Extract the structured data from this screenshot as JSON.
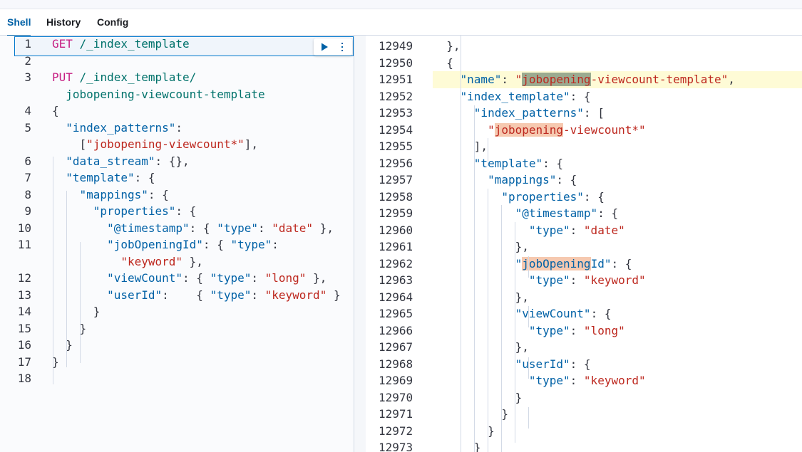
{
  "tabs": [
    {
      "label": "Shell",
      "active": true
    },
    {
      "label": "History",
      "active": false
    },
    {
      "label": "Config",
      "active": false
    }
  ],
  "request_actions": {
    "run_icon": "play-icon",
    "menu_icon": "more-vertical-icon"
  },
  "colors": {
    "accent": "#0061a6",
    "key": "#0061a6",
    "string": "#bd271e",
    "method": "#c61e82",
    "url": "#00726b",
    "selection": "#f6c9b0"
  },
  "left_editor": {
    "lines": [
      {
        "n": "1",
        "tokens": [
          [
            "m",
            "GET"
          ],
          [
            "u",
            " /_index_template"
          ]
        ]
      },
      {
        "n": "2",
        "tokens": []
      },
      {
        "n": "3",
        "tokens": [
          [
            "m",
            "PUT"
          ],
          [
            "u",
            " /_index_template/"
          ]
        ]
      },
      {
        "n": "",
        "tokens": [
          [
            "u",
            "  jobopening-viewcount-template"
          ]
        ]
      },
      {
        "n": "4",
        "tokens": [
          [
            "p",
            "{"
          ]
        ]
      },
      {
        "n": "5",
        "tokens": [
          [
            "p",
            "  "
          ],
          [
            "k",
            "\"index_patterns\""
          ],
          [
            "p",
            ":"
          ]
        ]
      },
      {
        "n": "",
        "tokens": [
          [
            "p",
            "    ["
          ],
          [
            "s",
            "\"jobopening-viewcount*\""
          ],
          [
            "p",
            "],"
          ]
        ]
      },
      {
        "n": "6",
        "tokens": [
          [
            "p",
            "  "
          ],
          [
            "k",
            "\"data_stream\""
          ],
          [
            "p",
            ": {},"
          ]
        ]
      },
      {
        "n": "7",
        "tokens": [
          [
            "p",
            "  "
          ],
          [
            "k",
            "\"template\""
          ],
          [
            "p",
            ": {"
          ]
        ]
      },
      {
        "n": "8",
        "tokens": [
          [
            "p",
            "    "
          ],
          [
            "k",
            "\"mappings\""
          ],
          [
            "p",
            ": {"
          ]
        ]
      },
      {
        "n": "9",
        "tokens": [
          [
            "p",
            "      "
          ],
          [
            "k",
            "\"properties\""
          ],
          [
            "p",
            ": {"
          ]
        ]
      },
      {
        "n": "10",
        "tokens": [
          [
            "p",
            "        "
          ],
          [
            "k",
            "\"@timestamp\""
          ],
          [
            "p",
            ": { "
          ],
          [
            "k",
            "\"type\""
          ],
          [
            "p",
            ": "
          ],
          [
            "s",
            "\"date\""
          ],
          [
            "p",
            " },"
          ]
        ]
      },
      {
        "n": "11",
        "tokens": [
          [
            "p",
            "        "
          ],
          [
            "k",
            "\"jobOpeningId\""
          ],
          [
            "p",
            ": { "
          ],
          [
            "k",
            "\"type\""
          ],
          [
            "p",
            ":"
          ]
        ]
      },
      {
        "n": "",
        "tokens": [
          [
            "p",
            "          "
          ],
          [
            "s",
            "\"keyword\""
          ],
          [
            "p",
            " },"
          ]
        ]
      },
      {
        "n": "12",
        "tokens": [
          [
            "p",
            "        "
          ],
          [
            "k",
            "\"viewCount\""
          ],
          [
            "p",
            ": { "
          ],
          [
            "k",
            "\"type\""
          ],
          [
            "p",
            ": "
          ],
          [
            "s",
            "\"long\""
          ],
          [
            "p",
            " },"
          ]
        ]
      },
      {
        "n": "13",
        "tokens": [
          [
            "p",
            "        "
          ],
          [
            "k",
            "\"userId\""
          ],
          [
            "p",
            ":    { "
          ],
          [
            "k",
            "\"type\""
          ],
          [
            "p",
            ": "
          ],
          [
            "s",
            "\"keyword\""
          ],
          [
            "p",
            " }"
          ]
        ]
      },
      {
        "n": "14",
        "tokens": [
          [
            "p",
            "      }"
          ]
        ]
      },
      {
        "n": "15",
        "tokens": [
          [
            "p",
            "    }"
          ]
        ]
      },
      {
        "n": "16",
        "tokens": [
          [
            "p",
            "  }"
          ]
        ]
      },
      {
        "n": "17",
        "tokens": [
          [
            "p",
            "}"
          ]
        ]
      },
      {
        "n": "18",
        "tokens": []
      }
    ]
  },
  "right_output": {
    "lines": [
      {
        "n": "12949",
        "tokens": [
          [
            "p",
            "  },"
          ]
        ]
      },
      {
        "n": "12950",
        "tokens": [
          [
            "p",
            "  {"
          ]
        ]
      },
      {
        "n": "12951",
        "line_hl": true,
        "tokens": [
          [
            "p",
            "    "
          ],
          [
            "k",
            "\"name\""
          ],
          [
            "p",
            ": "
          ],
          [
            "s",
            "\""
          ],
          [
            "s",
            "jobopening",
            "grey"
          ],
          [
            "s",
            "-viewcount-template\""
          ],
          [
            "p",
            ","
          ]
        ]
      },
      {
        "n": "12952",
        "tokens": [
          [
            "p",
            "    "
          ],
          [
            "k",
            "\"index_template\""
          ],
          [
            "p",
            ": {"
          ]
        ]
      },
      {
        "n": "12953",
        "tokens": [
          [
            "p",
            "      "
          ],
          [
            "k",
            "\"index_patterns\""
          ],
          [
            "p",
            ": ["
          ]
        ]
      },
      {
        "n": "12954",
        "tokens": [
          [
            "p",
            "        "
          ],
          [
            "s",
            "\""
          ],
          [
            "s",
            "jobopening",
            "orange"
          ],
          [
            "s",
            "-viewcount*\""
          ]
        ]
      },
      {
        "n": "12955",
        "tokens": [
          [
            "p",
            "      ],"
          ]
        ]
      },
      {
        "n": "12956",
        "tokens": [
          [
            "p",
            "      "
          ],
          [
            "k",
            "\"template\""
          ],
          [
            "p",
            ": {"
          ]
        ]
      },
      {
        "n": "12957",
        "tokens": [
          [
            "p",
            "        "
          ],
          [
            "k",
            "\"mappings\""
          ],
          [
            "p",
            ": {"
          ]
        ]
      },
      {
        "n": "12958",
        "tokens": [
          [
            "p",
            "          "
          ],
          [
            "k",
            "\"properties\""
          ],
          [
            "p",
            ": {"
          ]
        ]
      },
      {
        "n": "12959",
        "tokens": [
          [
            "p",
            "            "
          ],
          [
            "k",
            "\"@timestamp\""
          ],
          [
            "p",
            ": {"
          ]
        ]
      },
      {
        "n": "12960",
        "tokens": [
          [
            "p",
            "              "
          ],
          [
            "k",
            "\"type\""
          ],
          [
            "p",
            ": "
          ],
          [
            "s",
            "\"date\""
          ]
        ]
      },
      {
        "n": "12961",
        "tokens": [
          [
            "p",
            "            },"
          ]
        ]
      },
      {
        "n": "12962",
        "tokens": [
          [
            "p",
            "            "
          ],
          [
            "k",
            "\""
          ],
          [
            "k",
            "jobOpening",
            "orange"
          ],
          [
            "k",
            "Id\""
          ],
          [
            "p",
            ": {"
          ]
        ]
      },
      {
        "n": "12963",
        "tokens": [
          [
            "p",
            "              "
          ],
          [
            "k",
            "\"type\""
          ],
          [
            "p",
            ": "
          ],
          [
            "s",
            "\"keyword\""
          ]
        ]
      },
      {
        "n": "12964",
        "tokens": [
          [
            "p",
            "            },"
          ]
        ]
      },
      {
        "n": "12965",
        "tokens": [
          [
            "p",
            "            "
          ],
          [
            "k",
            "\"viewCount\""
          ],
          [
            "p",
            ": {"
          ]
        ]
      },
      {
        "n": "12966",
        "tokens": [
          [
            "p",
            "              "
          ],
          [
            "k",
            "\"type\""
          ],
          [
            "p",
            ": "
          ],
          [
            "s",
            "\"long\""
          ]
        ]
      },
      {
        "n": "12967",
        "tokens": [
          [
            "p",
            "            },"
          ]
        ]
      },
      {
        "n": "12968",
        "tokens": [
          [
            "p",
            "            "
          ],
          [
            "k",
            "\"userId\""
          ],
          [
            "p",
            ": {"
          ]
        ]
      },
      {
        "n": "12969",
        "tokens": [
          [
            "p",
            "              "
          ],
          [
            "k",
            "\"type\""
          ],
          [
            "p",
            ": "
          ],
          [
            "s",
            "\"keyword\""
          ]
        ]
      },
      {
        "n": "12970",
        "tokens": [
          [
            "p",
            "            }"
          ]
        ]
      },
      {
        "n": "12971",
        "tokens": [
          [
            "p",
            "          }"
          ]
        ]
      },
      {
        "n": "12972",
        "tokens": [
          [
            "p",
            "        }"
          ]
        ]
      },
      {
        "n": "12973",
        "tokens": [
          [
            "p",
            "      }"
          ]
        ]
      }
    ]
  }
}
